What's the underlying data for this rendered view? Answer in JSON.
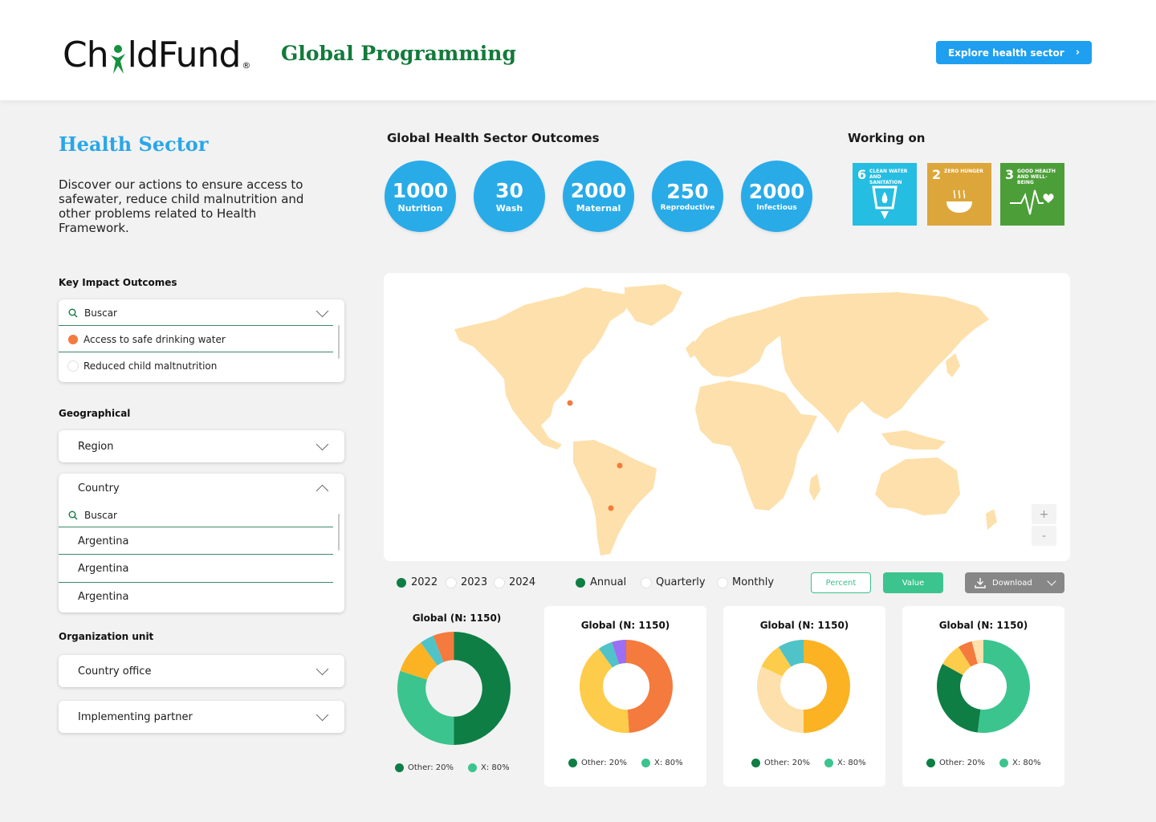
{
  "header": {
    "logo_left": "Ch",
    "logo_right": "ldFund",
    "logo_reg": "®",
    "program_title": "Global Programming",
    "explore_button": "Explore health sector"
  },
  "sidebar": {
    "title": "Health Sector",
    "description": "Discover our actions to ensure access to safewater, reduce child malnutrition and other problems related to Health Framework.",
    "key_impact": {
      "label": "Key Impact Outcomes",
      "search_placeholder": "Buscar",
      "options": [
        {
          "label": "Access to safe drinking water",
          "selected": true
        },
        {
          "label": "Reduced child maltnutrition",
          "selected": false
        }
      ]
    },
    "geographical": {
      "label": "Geographical",
      "region_label": "Region",
      "country_label": "Country",
      "search_placeholder": "Buscar",
      "countries": [
        "Argentina",
        "Argentina",
        "Argentina"
      ]
    },
    "organization": {
      "label": "Organization unit",
      "country_office": "Country office",
      "implementing_partner": "Implementing partner"
    }
  },
  "outcomes": {
    "title": "Global Health Sector Outcomes",
    "items": [
      {
        "value": "1000",
        "label": "Nutrition"
      },
      {
        "value": "30",
        "label": "Wash"
      },
      {
        "value": "2000",
        "label": "Maternal"
      },
      {
        "value": "250",
        "label": "Reproductive"
      },
      {
        "value": "2000",
        "label": "Infectious"
      }
    ],
    "color": "#29abe8"
  },
  "working_on": {
    "title": "Working on",
    "goals": [
      {
        "number": "6",
        "text": "CLEAN WATER AND SANITATION",
        "color": "#26bde2",
        "icon": "water-icon"
      },
      {
        "number": "2",
        "text": "ZERO HUNGER",
        "color": "#dda63a",
        "icon": "bowl-icon"
      },
      {
        "number": "3",
        "text": "GOOD HEALTH AND WELL-BEING",
        "color": "#4c9f38",
        "icon": "heartbeat-icon"
      }
    ]
  },
  "map": {
    "land_color": "#fde0ab",
    "marker_color": "#f47a3d",
    "zoom_in": "+",
    "zoom_out": "-"
  },
  "filters": {
    "years": [
      {
        "label": "2022",
        "selected": true
      },
      {
        "label": "2023",
        "selected": false
      },
      {
        "label": "2024",
        "selected": false
      }
    ],
    "periods": [
      {
        "label": "Annual",
        "selected": true
      },
      {
        "label": "Quarterly",
        "selected": false
      },
      {
        "label": "Monthly",
        "selected": false
      }
    ],
    "percent_label": "Percent",
    "value_label": "Value",
    "download_label": "Download"
  },
  "chart_data": [
    {
      "type": "pie",
      "title": "Global (N: 1150)",
      "slices": [
        {
          "value": 50,
          "color": "#0e7e45"
        },
        {
          "value": 30,
          "color": "#3cc48e"
        },
        {
          "value": 10,
          "color": "#fbb324"
        },
        {
          "value": 4,
          "color": "#4fc3c8"
        },
        {
          "value": 6,
          "color": "#f47a3d"
        }
      ],
      "legend": [
        {
          "label": "Other: 20%",
          "color": "#0e7e45"
        },
        {
          "label": "X: 80%",
          "color": "#3cc48e"
        }
      ]
    },
    {
      "type": "pie",
      "title": "Global (N: 1150)",
      "slices": [
        {
          "value": 49,
          "color": "#f47a3d"
        },
        {
          "value": 41,
          "color": "#fdcc4a"
        },
        {
          "value": 5,
          "color": "#4fc3c8"
        },
        {
          "value": 5,
          "color": "#9b6ef3"
        }
      ],
      "legend": [
        {
          "label": "Other: 20%",
          "color": "#0e7e45"
        },
        {
          "label": "X: 80%",
          "color": "#3cc48e"
        }
      ]
    },
    {
      "type": "pie",
      "title": "Global (N: 1150)",
      "slices": [
        {
          "value": 50,
          "color": "#fbb324"
        },
        {
          "value": 32,
          "color": "#fde0ab"
        },
        {
          "value": 9,
          "color": "#fdcc4a"
        },
        {
          "value": 9,
          "color": "#4fc3c8"
        }
      ],
      "legend": [
        {
          "label": "Other: 20%",
          "color": "#0e7e45"
        },
        {
          "label": "X: 80%",
          "color": "#3cc48e"
        }
      ]
    },
    {
      "type": "pie",
      "title": "Global (N: 1150)",
      "slices": [
        {
          "value": 52,
          "color": "#3cc48e"
        },
        {
          "value": 31,
          "color": "#0e7e45"
        },
        {
          "value": 8,
          "color": "#fdcc4a"
        },
        {
          "value": 5,
          "color": "#f47a3d"
        },
        {
          "value": 4,
          "color": "#fde0ab"
        }
      ],
      "legend": [
        {
          "label": "Other: 20%",
          "color": "#0e7e45"
        },
        {
          "label": "X: 80%",
          "color": "#3cc48e"
        }
      ]
    }
  ]
}
